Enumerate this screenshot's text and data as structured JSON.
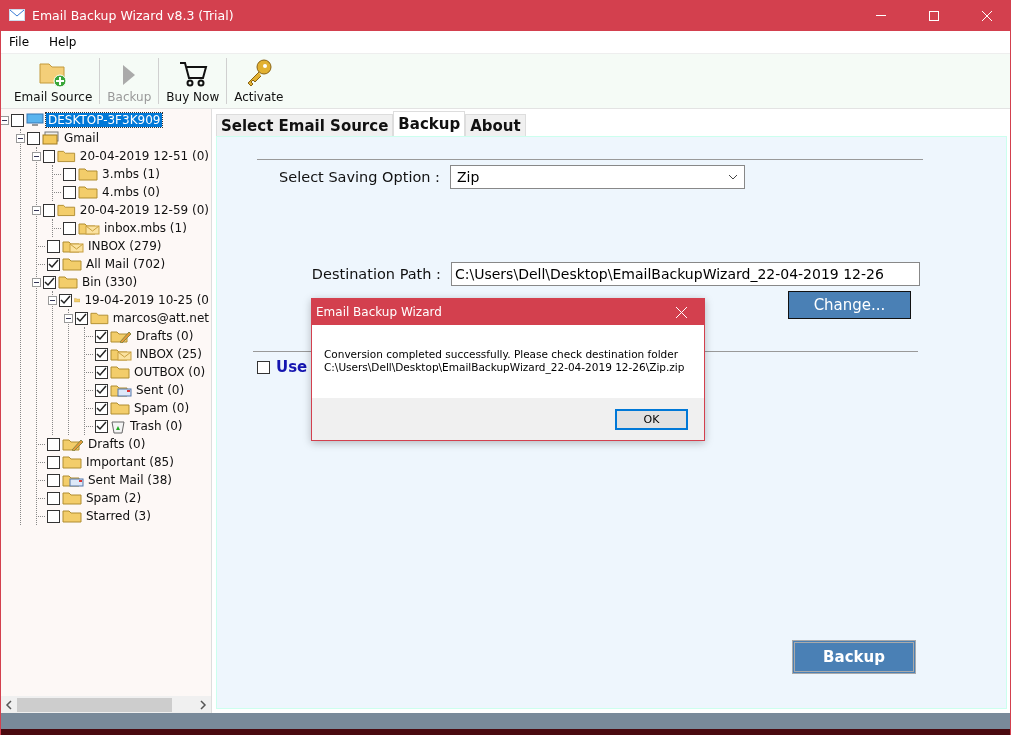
{
  "window": {
    "title": "Email Backup Wizard v8.3 (Trial)"
  },
  "menu": [
    "File",
    "Help"
  ],
  "toolbar": [
    {
      "label": "Email Source",
      "kind": "source",
      "disabled": false
    },
    {
      "label": "Backup",
      "kind": "backup",
      "disabled": true
    },
    {
      "label": "Buy Now",
      "kind": "cart",
      "disabled": false
    },
    {
      "label": "Activate",
      "kind": "key",
      "disabled": false
    }
  ],
  "tree": [
    {
      "label": "DESKTOP-3F3K909",
      "kind": "computer",
      "checked": false,
      "expanded": true,
      "selected": true,
      "children": [
        {
          "label": "Gmail",
          "kind": "mailstack",
          "checked": false,
          "expanded": true,
          "selected": false,
          "children": [
            {
              "label": "20-04-2019 12-51 (0)",
              "kind": "folder",
              "checked": false,
              "expanded": true,
              "selected": false,
              "children": [
                {
                  "label": "3.mbs (1)",
                  "kind": "folder",
                  "checked": false,
                  "selected": false
                },
                {
                  "label": "4.mbs (0)",
                  "kind": "folder",
                  "checked": false,
                  "selected": false
                }
              ]
            },
            {
              "label": "20-04-2019 12-59 (0)",
              "kind": "folder",
              "checked": false,
              "expanded": true,
              "selected": false,
              "children": [
                {
                  "label": "inbox.mbs (1)",
                  "kind": "mail",
                  "checked": false,
                  "selected": false
                }
              ]
            },
            {
              "label": "INBOX (279)",
              "kind": "mail",
              "checked": false,
              "selected": false
            },
            {
              "label": "All Mail (702)",
              "kind": "folder",
              "checked": true,
              "selected": false
            },
            {
              "label": "Bin (330)",
              "kind": "folder",
              "checked": true,
              "expanded": true,
              "selected": false,
              "children": [
                {
                  "label": "19-04-2019 10-25 (0",
                  "kind": "folder",
                  "checked": true,
                  "expanded": true,
                  "selected": false,
                  "children": [
                    {
                      "label": "marcos@att.net",
                      "kind": "folder",
                      "checked": true,
                      "expanded": true,
                      "selected": false,
                      "children": [
                        {
                          "label": "Drafts (0)",
                          "kind": "drafts",
                          "checked": true,
                          "selected": false
                        },
                        {
                          "label": "INBOX (25)",
                          "kind": "mail",
                          "checked": true,
                          "selected": false
                        },
                        {
                          "label": "OUTBOX (0)",
                          "kind": "folder",
                          "checked": true,
                          "selected": false
                        },
                        {
                          "label": "Sent (0)",
                          "kind": "sent",
                          "checked": true,
                          "selected": false
                        },
                        {
                          "label": "Spam (0)",
                          "kind": "folder",
                          "checked": true,
                          "selected": false
                        },
                        {
                          "label": "Trash (0)",
                          "kind": "trash",
                          "checked": true,
                          "selected": false
                        }
                      ]
                    }
                  ]
                }
              ]
            },
            {
              "label": "Drafts (0)",
              "kind": "drafts",
              "checked": false,
              "selected": false
            },
            {
              "label": "Important (85)",
              "kind": "folder",
              "checked": false,
              "selected": false
            },
            {
              "label": "Sent Mail (38)",
              "kind": "sent",
              "checked": false,
              "selected": false
            },
            {
              "label": "Spam (2)",
              "kind": "folder",
              "checked": false,
              "selected": false
            },
            {
              "label": "Starred (3)",
              "kind": "folder",
              "checked": false,
              "selected": false
            }
          ]
        }
      ]
    }
  ],
  "tabs": [
    {
      "label": "Select Email Source",
      "selected": false
    },
    {
      "label": "Backup",
      "selected": true
    },
    {
      "label": "About",
      "selected": false
    }
  ],
  "form": {
    "saving_option_label": "Select Saving Option :",
    "saving_option_value": "Zip",
    "destination_label": "Destination Path :",
    "destination_value": "C:\\Users\\Dell\\Desktop\\EmailBackupWizard_22-04-2019 12-26",
    "change_button": "Change...",
    "use_checkbox": {
      "label": "Use",
      "checked": false
    },
    "backup_button": "Backup"
  },
  "dialog": {
    "title": "Email Backup Wizard",
    "message": "Conversion completed successfully. Please check destination folder",
    "path": "C:\\Users\\Dell\\Desktop\\EmailBackupWizard_22-04-2019 12-26\\Zip.zip",
    "ok_button": "OK"
  }
}
